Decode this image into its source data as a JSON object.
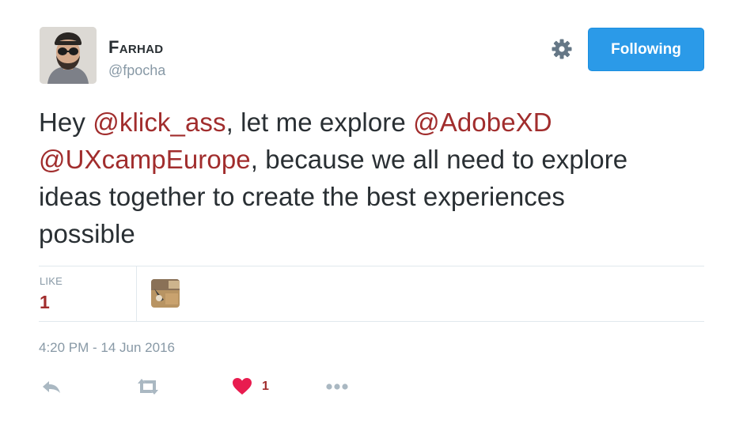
{
  "user": {
    "display_name": "Farhad",
    "handle": "@fpocha",
    "avatar_icon": "user-avatar-photo"
  },
  "header": {
    "settings_icon": "gear-icon",
    "follow_button_label": "Following",
    "follow_button_color": "#2b9ae8"
  },
  "tweet": {
    "text_parts": [
      "Hey ",
      "@klick_ass",
      ", let me explore ",
      "@AdobeXD",
      " ",
      "@UXcampEurope",
      ", because we all need to explore ideas together to create the best experiences possible"
    ],
    "mention_color": "#a12d2d"
  },
  "stats": {
    "likes_label": "LIKE",
    "likes_count": "1"
  },
  "timestamp": "4:20 PM - 14 Jun 2016",
  "actions": {
    "reply_icon": "reply-icon",
    "retweet_icon": "retweet-icon",
    "like_icon": "heart-icon",
    "like_count": "1",
    "more_icon": "more-dots-icon"
  }
}
